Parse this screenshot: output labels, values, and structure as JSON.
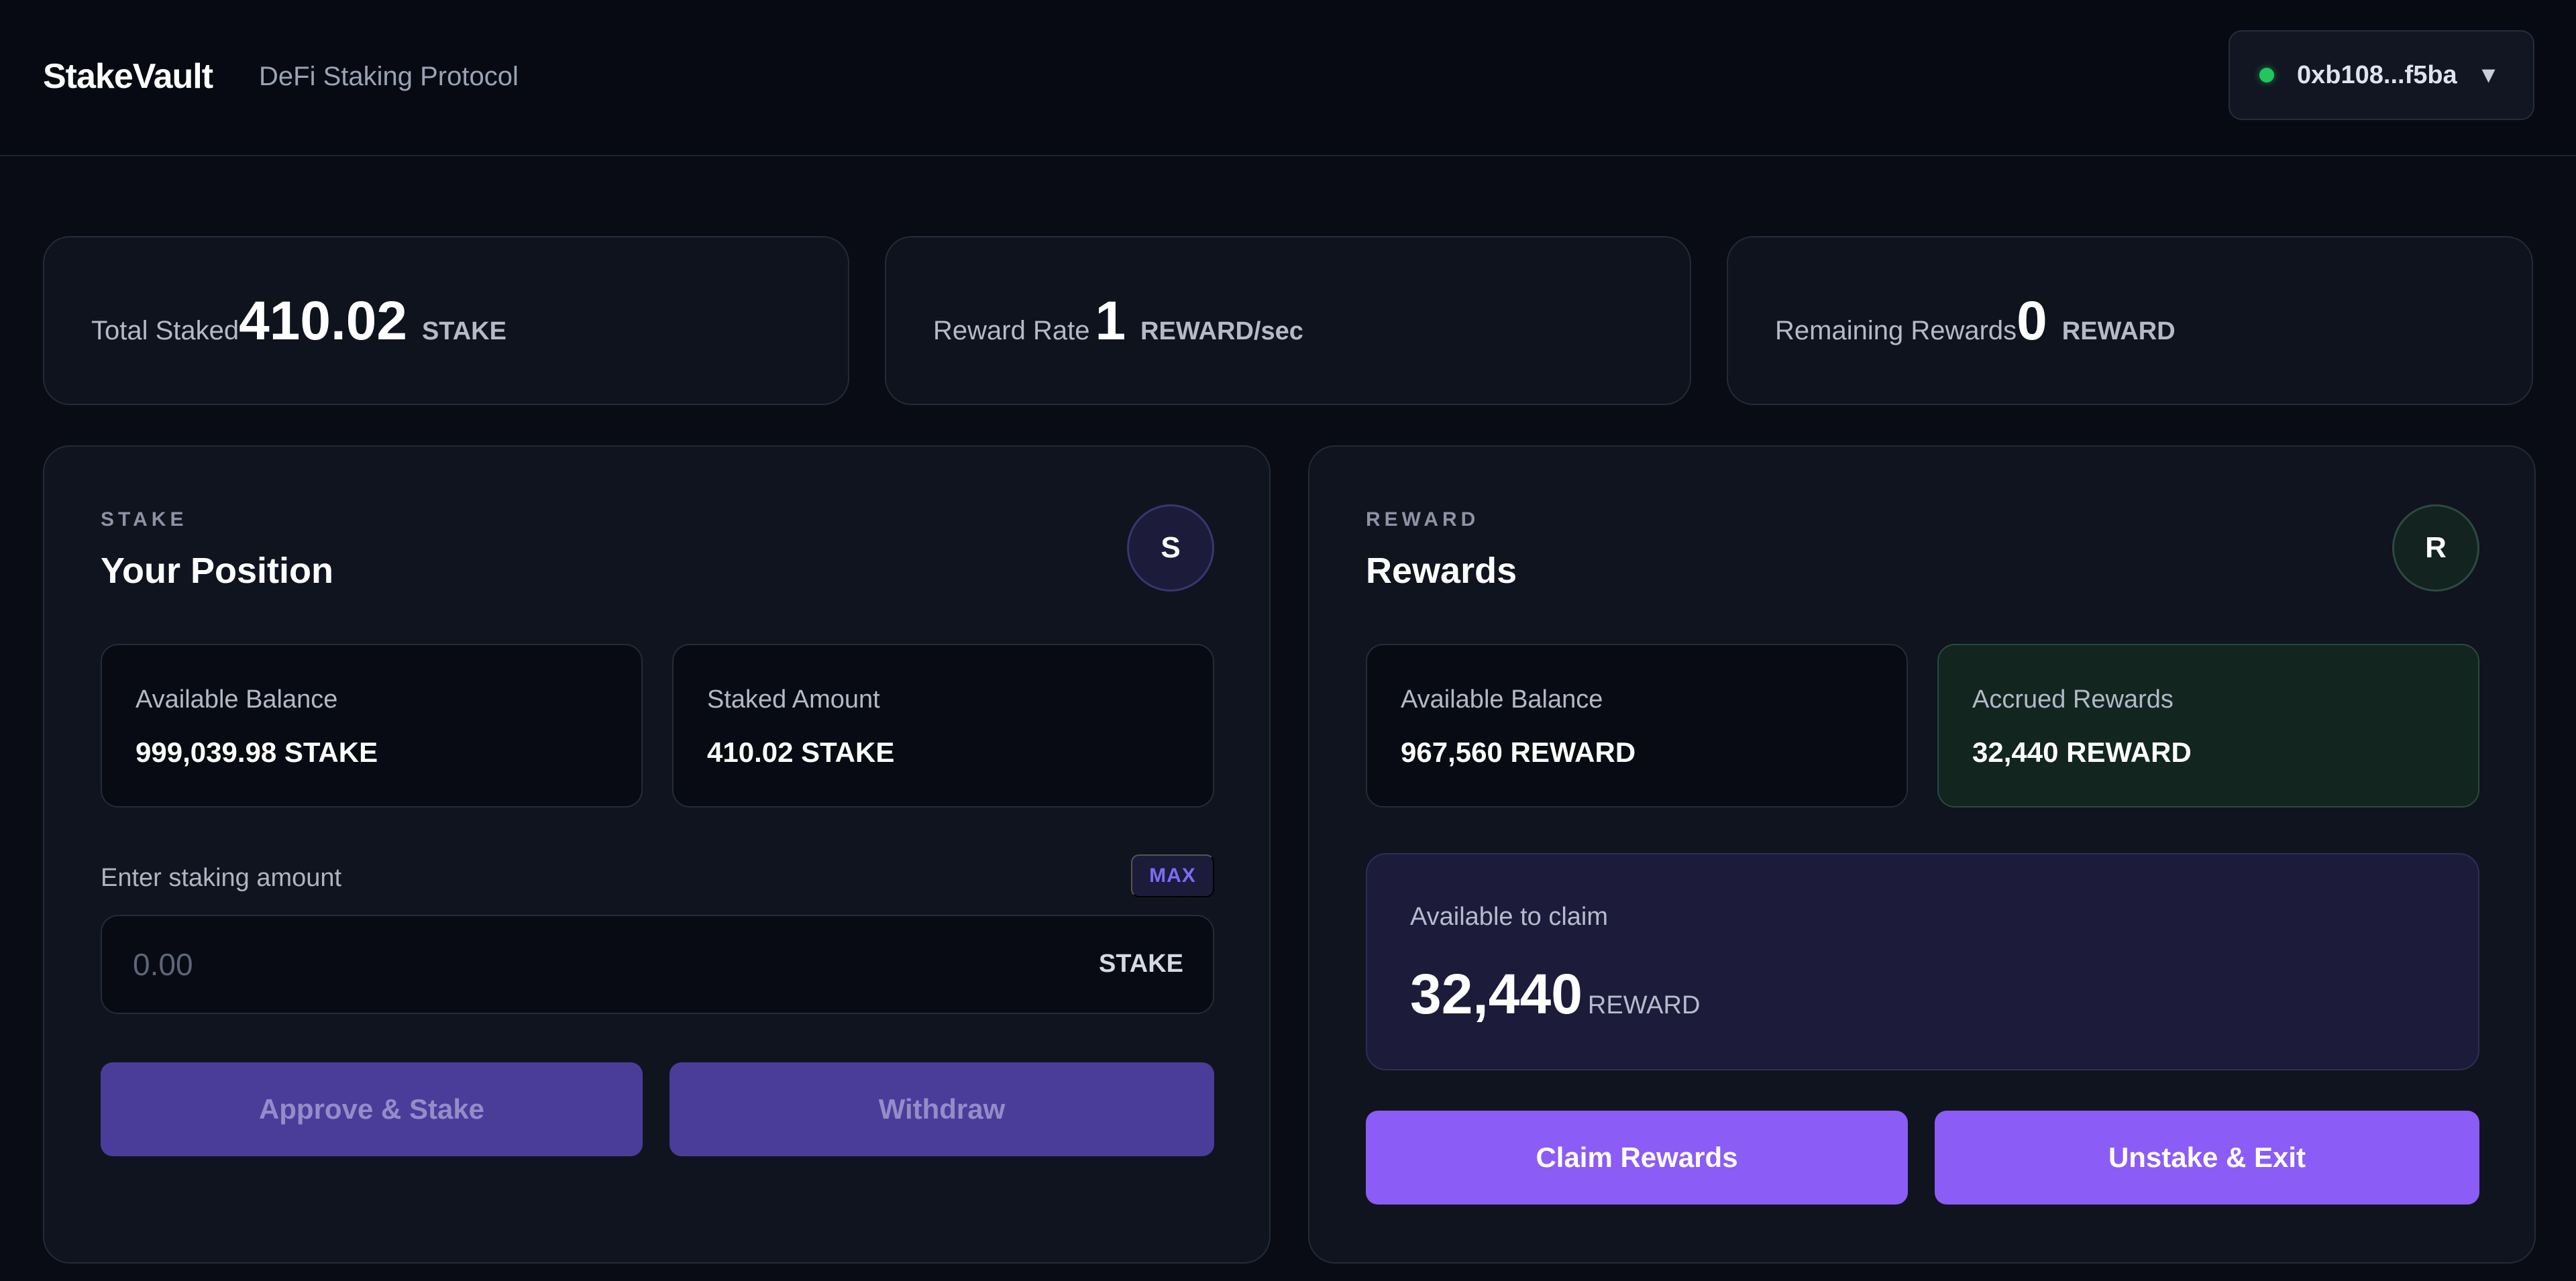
{
  "header": {
    "brand": "StakeVault",
    "tagline": "DeFi Staking Protocol",
    "wallet": {
      "address": "0xb108...f5ba",
      "status_color": "#22c55e",
      "caret": "▼"
    }
  },
  "stats": [
    {
      "label": "Total Staked",
      "value": "410.02",
      "unit": "STAKE"
    },
    {
      "label": "Reward Rate",
      "value": "1",
      "unit": "REWARD/sec"
    },
    {
      "label": "Remaining Rewards",
      "value": "0",
      "unit": "REWARD"
    }
  ],
  "stake_panel": {
    "eyebrow": "STAKE",
    "title": "Your Position",
    "badge": "S",
    "available_balance_label": "Available Balance",
    "available_balance_value": "999,039.98 STAKE",
    "staked_amount_label": "Staked Amount",
    "staked_amount_value": "410.02 STAKE",
    "input_label": "Enter staking amount",
    "max_label": "MAX",
    "input_placeholder": "0.00",
    "input_value": "",
    "input_unit": "STAKE",
    "approve_button": "Approve & Stake",
    "withdraw_button": "Withdraw"
  },
  "reward_panel": {
    "eyebrow": "REWARD",
    "title": "Rewards",
    "badge": "R",
    "available_balance_label": "Available Balance",
    "available_balance_value": "967,560 REWARD",
    "accrued_label": "Accrued Rewards",
    "accrued_value": "32,440 REWARD",
    "claim_label": "Available to claim",
    "claim_value": "32,440",
    "claim_unit": "REWARD",
    "claim_button": "Claim Rewards",
    "exit_button": "Unstake & Exit"
  },
  "colors": {
    "background": "#090c15",
    "accent": "#8b5cf6",
    "accent_disabled": "#4a3d9a",
    "success": "#22c55e"
  }
}
